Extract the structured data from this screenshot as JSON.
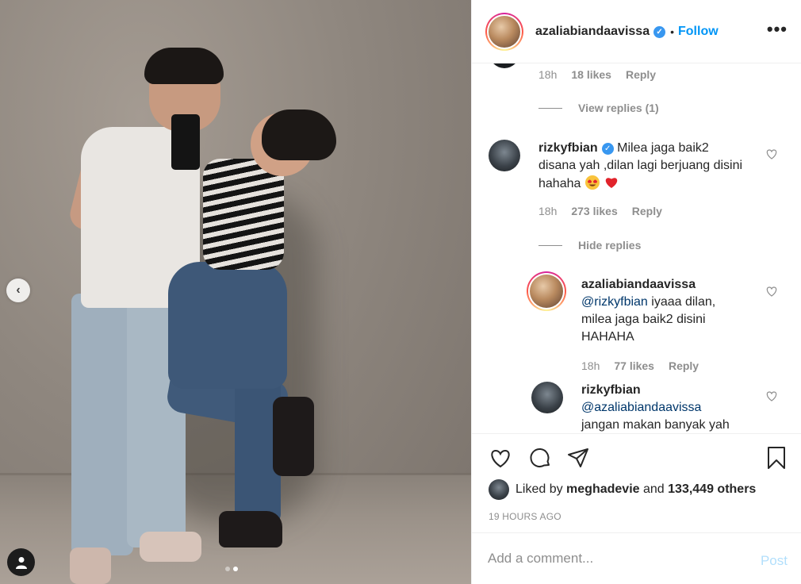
{
  "post": {
    "author": "azaliabiandaavissa",
    "follow_label": "Follow",
    "separator": "•",
    "verified_icon": "✓",
    "more_icon": "•••",
    "colors": {
      "accent": "#0095f6",
      "verified": "#3897f0",
      "muted": "#8e8e8e"
    }
  },
  "photo": {
    "prev_icon": "‹",
    "carousel_total": 2,
    "carousel_active": 2
  },
  "comments": {
    "c0": {
      "time": "18h",
      "likes": "18 likes",
      "reply": "Reply"
    },
    "c0_replies": "View replies (1)",
    "c1": {
      "username": "rizkyfbian",
      "text": "Milea jaga baik2 disana yah ,dilan lagi berjuang disini hahaha",
      "time": "18h",
      "likes": "273 likes",
      "reply": "Reply"
    },
    "c1_replies": "Hide replies",
    "r1": {
      "username": "azaliabiandaavissa",
      "mention": "@rizkyfbian",
      "text": "iyaaa dilan, milea jaga baik2 disini HAHAHA",
      "time": "18h",
      "likes": "77 likes",
      "reply": "Reply"
    },
    "r2": {
      "username": "rizkyfbian",
      "mention": "@azaliabiandaavissa",
      "text": "jangan makan banyak yah"
    }
  },
  "footer": {
    "liked_prefix": "Liked by",
    "liked_user": "meghadevie",
    "liked_and": "and",
    "liked_others": "133,449 others",
    "timestamp": "19 HOURS AGO",
    "comment_placeholder": "Add a comment...",
    "post_label": "Post"
  }
}
